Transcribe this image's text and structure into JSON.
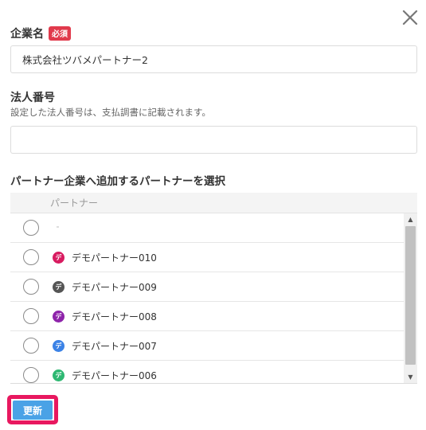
{
  "company_name": {
    "label": "企業名",
    "required_badge": "必須",
    "value": "株式会社ツバメパートナー2"
  },
  "corporate_number": {
    "label": "法人番号",
    "help": "設定した法人番号は、支払調書に記載されます。",
    "value": ""
  },
  "partner_section": {
    "title": "パートナー企業へ追加するパートナーを選択",
    "column_header": "パートナー",
    "rows": [
      {
        "name": "",
        "avatar": "",
        "color": ""
      },
      {
        "name": "デモパートナー010",
        "avatar": "デ",
        "color": "#d81b60"
      },
      {
        "name": "デモパートナー009",
        "avatar": "デ",
        "color": "#555555"
      },
      {
        "name": "デモパートナー008",
        "avatar": "デ",
        "color": "#8e24aa"
      },
      {
        "name": "デモパートナー007",
        "avatar": "デ",
        "color": "#3b82e6"
      },
      {
        "name": "デモパートナー006",
        "avatar": "デ",
        "color": "#2eb872"
      }
    ]
  },
  "update_button": "更新",
  "colors": {
    "required": "#e13a4c",
    "button": "#4aa2e6",
    "highlight": "#e8185f"
  }
}
